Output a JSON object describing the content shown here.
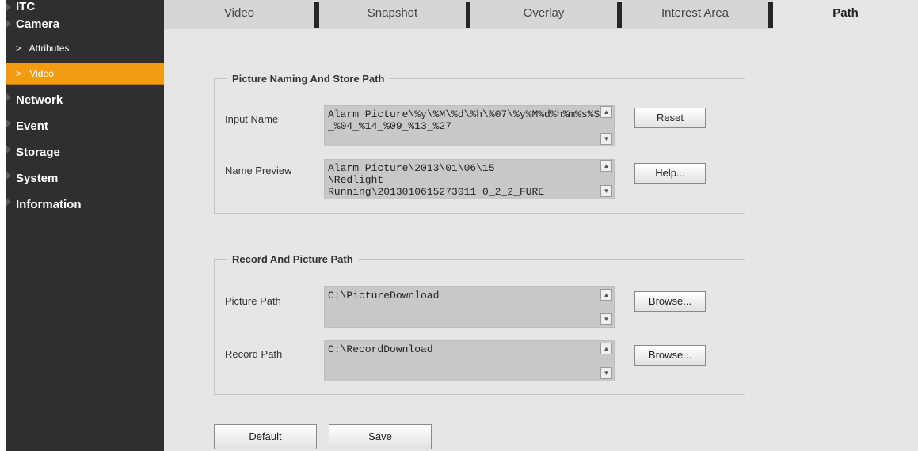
{
  "sidebar": {
    "sections": [
      {
        "label": "ITC"
      },
      {
        "label": "Camera"
      },
      {
        "label": "Network"
      },
      {
        "label": "Event"
      },
      {
        "label": "Storage"
      },
      {
        "label": "System"
      },
      {
        "label": "Information"
      }
    ],
    "camera_sub": [
      {
        "label": "Attributes",
        "active": false
      },
      {
        "label": "Video",
        "active": true
      }
    ]
  },
  "tabs": [
    {
      "label": "Video"
    },
    {
      "label": "Snapshot"
    },
    {
      "label": "Overlay"
    },
    {
      "label": "Interest Area"
    },
    {
      "label": "Path",
      "active": true
    }
  ],
  "naming": {
    "legend": "Picture Naming And Store Path",
    "input_name_label": "Input Name",
    "input_name_value": "Alarm Picture\\%y\\%M\\%d\\%h\\%07\\%y%M%d%h%m%s%S_%04_%14_%09_%13_%27",
    "preview_label": "Name Preview",
    "preview_value": "Alarm Picture\\2013\\01\\06\\15\n\\Redlight\nRunning\\2013010615273011 0_2_2_FURE",
    "reset_label": "Reset",
    "help_label": "Help..."
  },
  "paths": {
    "legend": "Record And Picture Path",
    "picture_label": "Picture Path",
    "picture_value": "C:\\PictureDownload",
    "record_label": "Record Path",
    "record_value": "C:\\RecordDownload",
    "browse_label": "Browse..."
  },
  "footer": {
    "default_label": "Default",
    "save_label": "Save"
  },
  "colors": {
    "sidebar_bg": "#2f2f2f",
    "active_orange": "#f39c12",
    "content_bg": "#e6e6e6",
    "tab_bg": "#d6d6d6"
  }
}
